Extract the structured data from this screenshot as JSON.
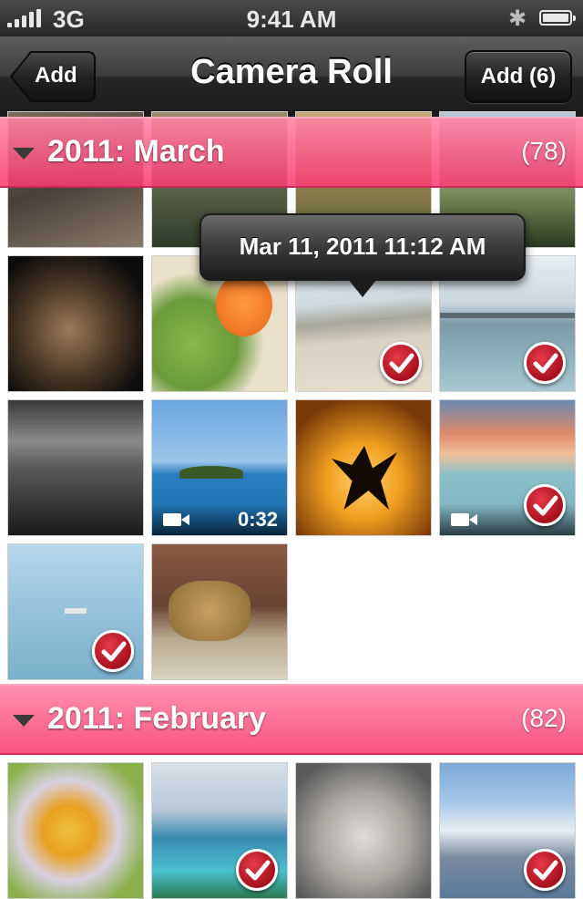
{
  "status_bar": {
    "carrier": "3G",
    "time": "9:41 AM"
  },
  "nav": {
    "back_label": "Add",
    "title": "Camera Roll",
    "right_label": "Add (6)"
  },
  "sections": [
    {
      "title": "2011: March",
      "count": "(78)"
    },
    {
      "title": "2011: February",
      "count": "(82)"
    }
  ],
  "tooltip": "Mar 11, 2011 11:12 AM",
  "video_duration": "0:32"
}
